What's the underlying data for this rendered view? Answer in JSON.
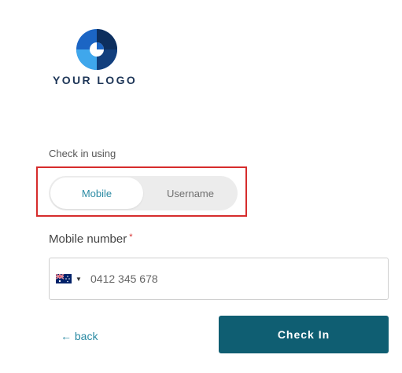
{
  "logo": {
    "text": "YOUR LOGO"
  },
  "form": {
    "checkin_label": "Check in using",
    "toggle": {
      "options": [
        "Mobile",
        "Username"
      ],
      "selected": "Mobile"
    },
    "mobile_label": "Mobile number",
    "required_marker": "*",
    "phone": {
      "country_icon": "australia-flag-icon",
      "placeholder": "0412 345 678"
    },
    "back_label": "← back",
    "submit_label": "Check In"
  },
  "colors": {
    "accent": "#2a8aa3",
    "button": "#0f5e72",
    "highlight_border": "#d62c2c",
    "logo_text": "#1d3557"
  }
}
